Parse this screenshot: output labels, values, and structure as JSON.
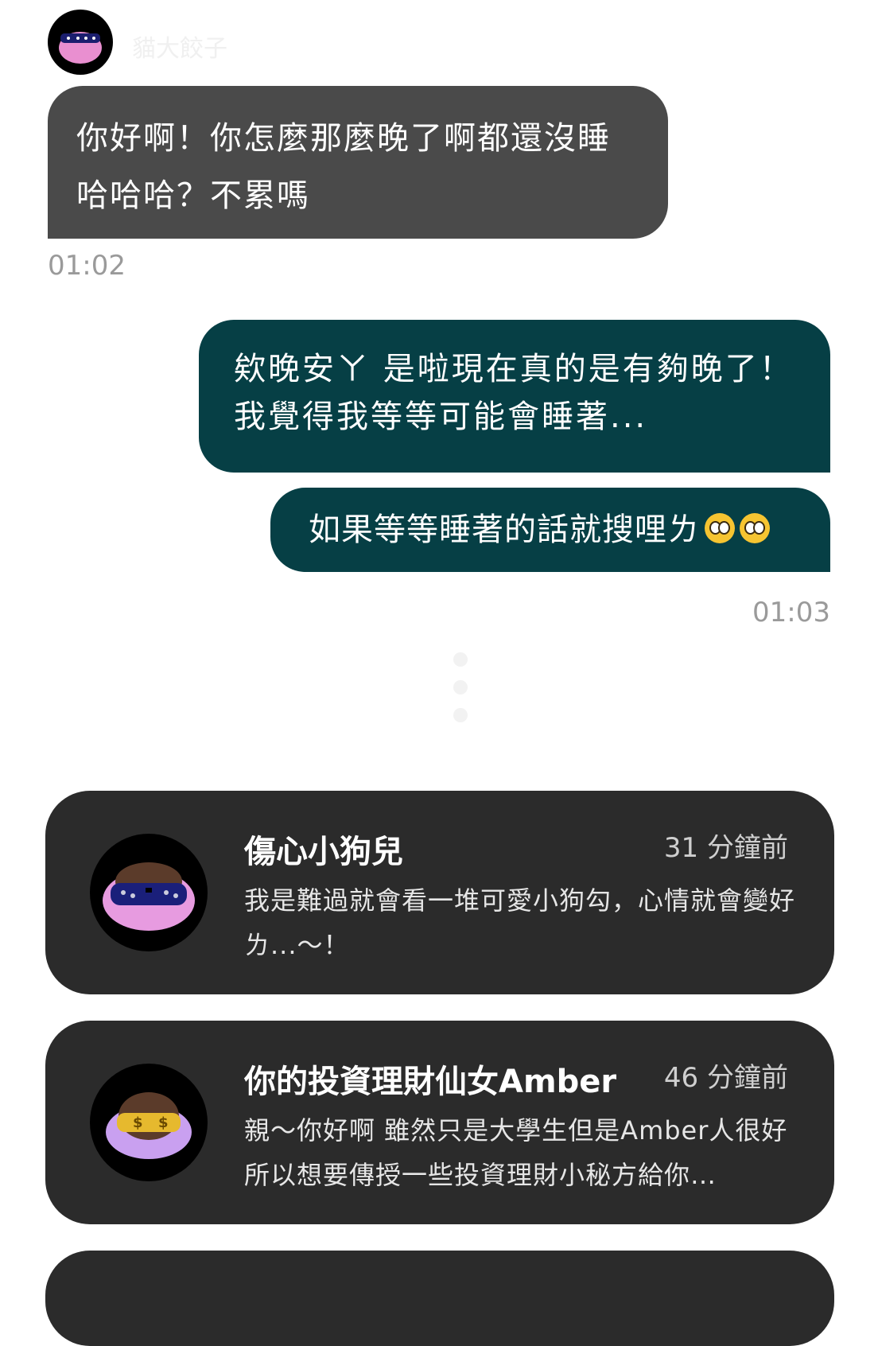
{
  "header": {
    "partner_name": "貓大餃子"
  },
  "messages": [
    {
      "side": "in",
      "text": "你好啊！你怎麼那麼晚了啊都還沒睡哈哈哈？不累嗎"
    },
    {
      "side": "in",
      "time": "01:02"
    },
    {
      "side": "out",
      "text": "欸晚安ㄚ 是啦現在真的是有夠晚了！我覺得我等等可能會睡著..."
    },
    {
      "side": "out",
      "text": "如果等等睡著的話就搜哩ㄌ"
    },
    {
      "side": "out",
      "time": "01:03"
    }
  ],
  "emojis": [
    "pleading-face",
    "pleading-face"
  ],
  "conversations": [
    {
      "name": "傷心小狗兒",
      "ago": "31 分鐘前",
      "preview": "我是難過就會看一堆可愛小狗勾，心情就會變好ㄌ...～！",
      "avatar_style": "blue-glasses"
    },
    {
      "name": "你的投資理財仙女Amber",
      "ago": "46 分鐘前",
      "preview": "親～你好啊 雖然只是大學生但是Amber人很好所以想要傳授一些投資理財小秘方給你…",
      "avatar_style": "dollar-glasses"
    }
  ],
  "colors": {
    "incoming_bubble": "#4a4a4a",
    "outgoing_bubble": "#063f45",
    "card_bg": "#2b2b2b"
  }
}
